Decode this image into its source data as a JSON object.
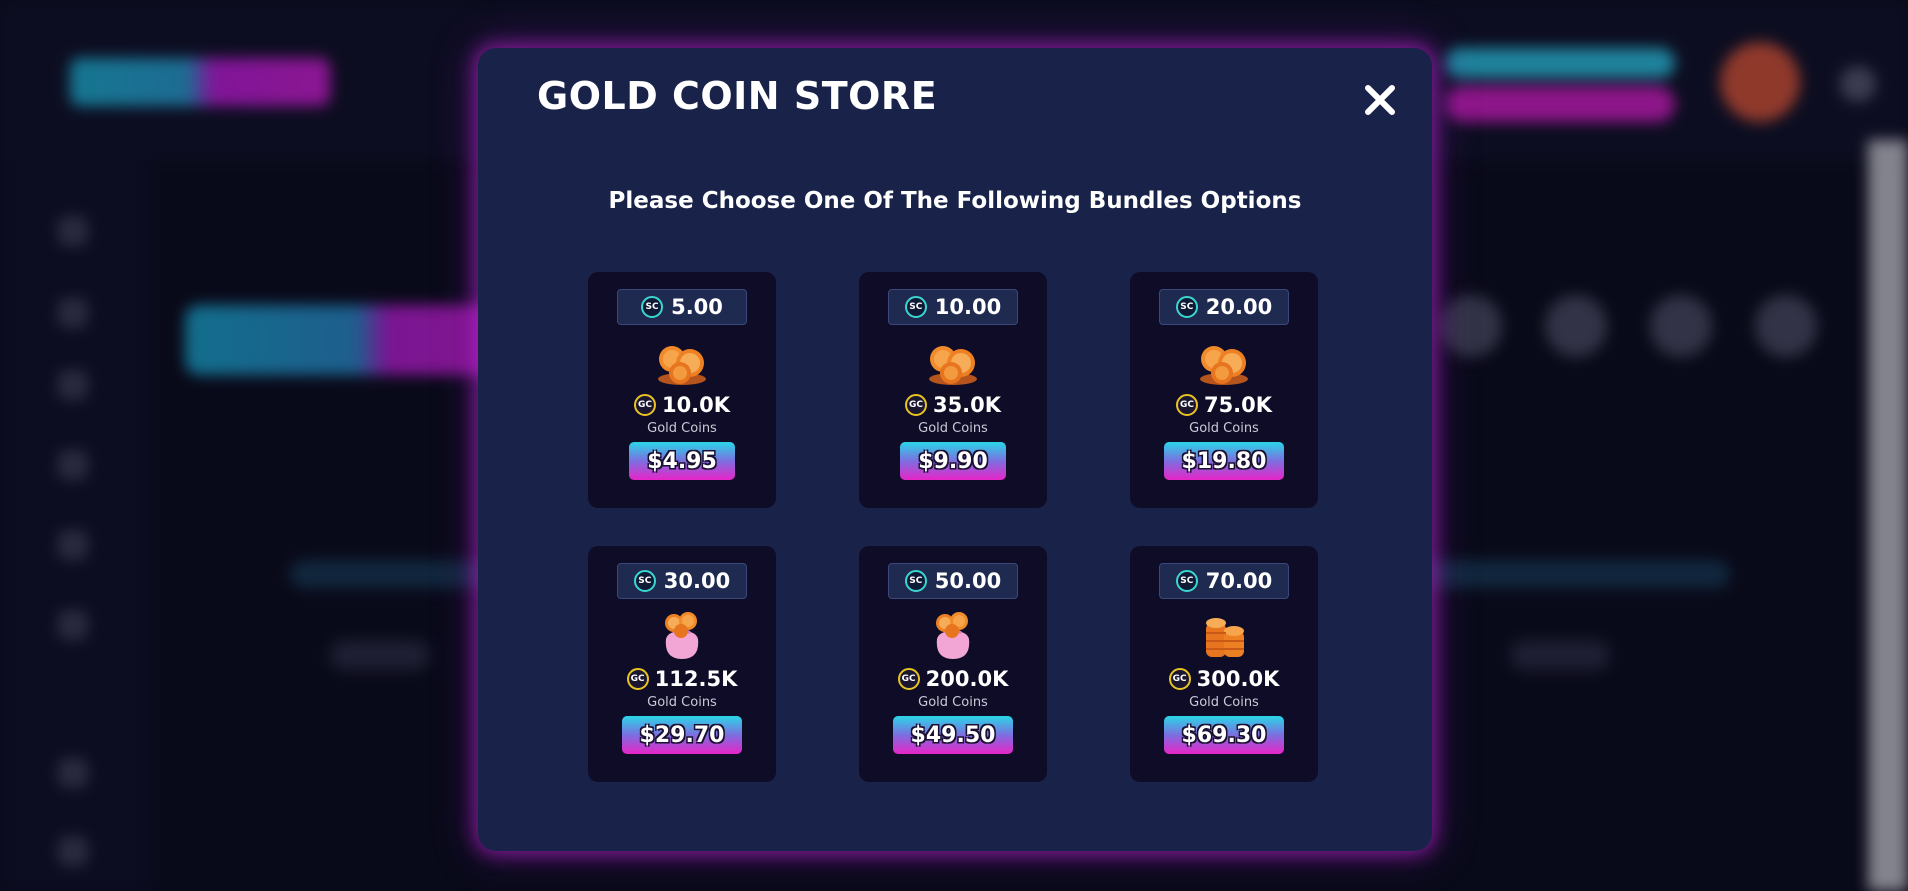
{
  "modal": {
    "title": "GOLD COIN STORE",
    "close_icon": "close-icon",
    "subtitle": "Please Choose One Of The Following Bundles Options"
  },
  "currency": {
    "sweep_coin_symbol": "SC",
    "gold_coin_symbol": "GC",
    "sweep_coin_color": "#39d7d0",
    "gold_coin_color": "#e8c322"
  },
  "bundles": [
    {
      "sc": "5.00",
      "gc": "10.0K",
      "gc_label": "Gold Coins",
      "price": "$4.95",
      "image": "coin-pile-icon"
    },
    {
      "sc": "10.00",
      "gc": "35.0K",
      "gc_label": "Gold Coins",
      "price": "$9.90",
      "image": "coin-pile-icon"
    },
    {
      "sc": "20.00",
      "gc": "75.0K",
      "gc_label": "Gold Coins",
      "price": "$19.80",
      "image": "coin-pile-icon"
    },
    {
      "sc": "30.00",
      "gc": "112.5K",
      "gc_label": "Gold Coins",
      "price": "$29.70",
      "image": "coin-bag-icon"
    },
    {
      "sc": "50.00",
      "gc": "200.0K",
      "gc_label": "Gold Coins",
      "price": "$49.50",
      "image": "coin-bag-icon"
    },
    {
      "sc": "70.00",
      "gc": "300.0K",
      "gc_label": "Gold Coins",
      "price": "$69.30",
      "image": "coin-stack-icon"
    }
  ],
  "colors": {
    "modal_bg": "#192349",
    "card_bg": "#0f0c28",
    "price_gradient_top": "#2ad6e8",
    "price_gradient_bottom": "#e824c8",
    "modal_glow": "#c424d6"
  }
}
